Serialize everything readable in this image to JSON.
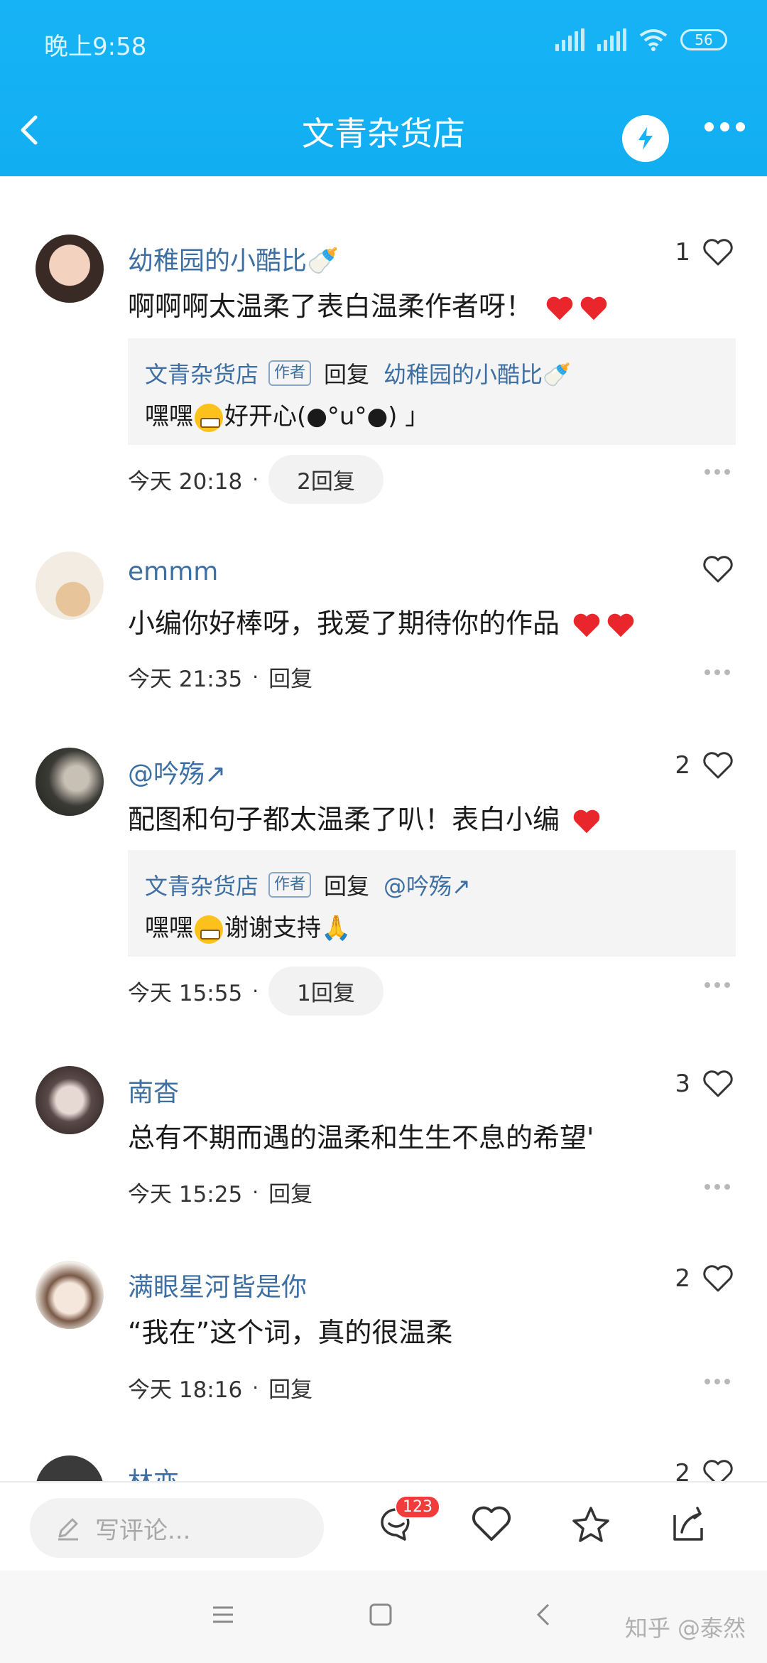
{
  "status_bar": {
    "time": "晚上9:58",
    "battery": "56"
  },
  "header": {
    "title": "文青杂货店"
  },
  "comments": [
    {
      "username": "幼稚园的小酷比🍼",
      "likes": "1",
      "text": "啊啊啊太温柔了表白温柔作者呀！",
      "reply": {
        "author": "文青杂货店",
        "tag": "作者",
        "verb": "回复",
        "target": "幼稚园的小酷比🍼",
        "text_before": "嘿嘿",
        "text_after": "好开心(●°u°●)​ 」"
      },
      "time": "今天 20:18",
      "reply_action": "2回复"
    },
    {
      "username": "emmm",
      "likes": "",
      "text": "小编你好棒呀，我爱了期待你的作品",
      "time": "今天 21:35",
      "reply_action": "回复"
    },
    {
      "username": "@吟殇↗",
      "likes": "2",
      "text": "配图和句子都太温柔了叭！表白小编",
      "reply": {
        "author": "文青杂货店",
        "tag": "作者",
        "verb": "回复",
        "target": "@吟殇↗",
        "text_before": "嘿嘿",
        "text_after": "谢谢支持🙏"
      },
      "time": "今天 15:55",
      "reply_action": "1回复"
    },
    {
      "username": "南杳",
      "likes": "3",
      "text": "总有不期而遇的温柔和生生不息的希望'",
      "time": "今天 15:25",
      "reply_action": "回复"
    },
    {
      "username": "满眼星河皆是你",
      "likes": "2",
      "text": "“我在”这个词，真的很温柔",
      "time": "今天 18:16",
      "reply_action": "回复"
    },
    {
      "username": "林亦",
      "likes": "2"
    }
  ],
  "bottom_bar": {
    "placeholder": "写评论...",
    "comment_count": "123"
  },
  "watermark": "知乎 @泰然",
  "icons": [
    "back-icon",
    "bolt-icon",
    "more-icon",
    "heart-icon",
    "ellipsis-icon",
    "pencil-icon",
    "comment-icon",
    "star-icon",
    "share-icon",
    "menu-icon",
    "home-icon",
    "nav-back-icon"
  ],
  "colors": {
    "header": "#16b3f5",
    "username": "#3e6fa2",
    "badge": "#f23c3c"
  }
}
